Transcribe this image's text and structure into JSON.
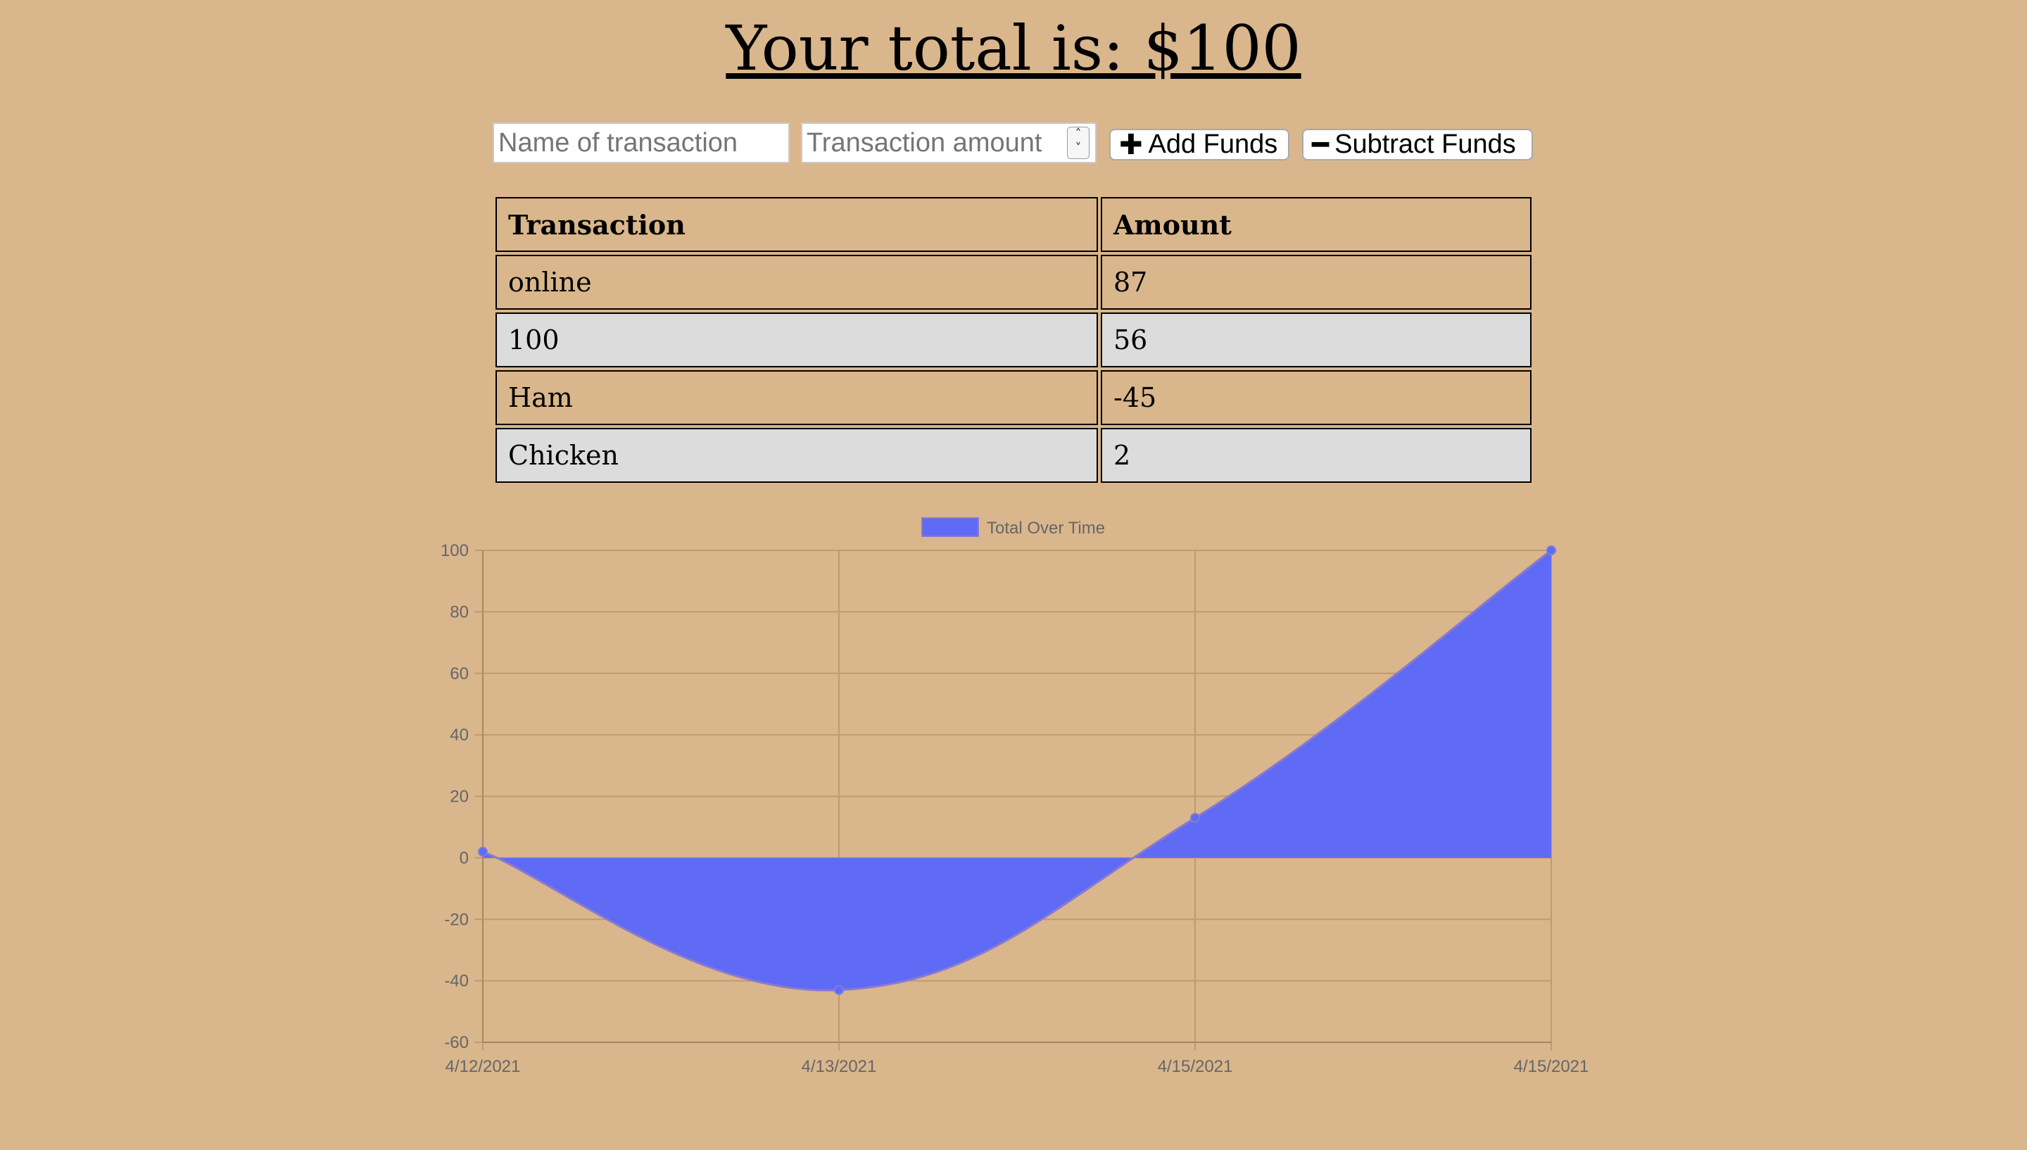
{
  "header": {
    "title": "Your total is: $100"
  },
  "form": {
    "name_placeholder": "Name of transaction",
    "amount_placeholder": "Transaction amount",
    "add_label": "Add Funds",
    "subtract_label": "Subtract Funds"
  },
  "table": {
    "headers": [
      "Transaction",
      "Amount"
    ],
    "rows": [
      {
        "name": "online",
        "amount": "87"
      },
      {
        "name": "100",
        "amount": "56"
      },
      {
        "name": "Ham",
        "amount": "-45"
      },
      {
        "name": "Chicken",
        "amount": "2"
      }
    ]
  },
  "chart_data": {
    "type": "area",
    "legend": [
      "Total Over Time"
    ],
    "legend_position": "top-center",
    "categories": [
      "4/12/2021",
      "4/13/2021",
      "4/15/2021",
      "4/15/2021"
    ],
    "series": [
      {
        "name": "Total Over Time",
        "values": [
          2,
          -43,
          13,
          100
        ],
        "color": "#5f6af5"
      }
    ],
    "ylim": [
      -60,
      100
    ],
    "yticks": [
      100,
      80,
      60,
      40,
      20,
      0,
      -20,
      -40,
      -60
    ],
    "grid": true
  },
  "colors": {
    "background": "#d9b68c",
    "fill": "#5f6af5",
    "alt_row": "#dcdcdc"
  }
}
